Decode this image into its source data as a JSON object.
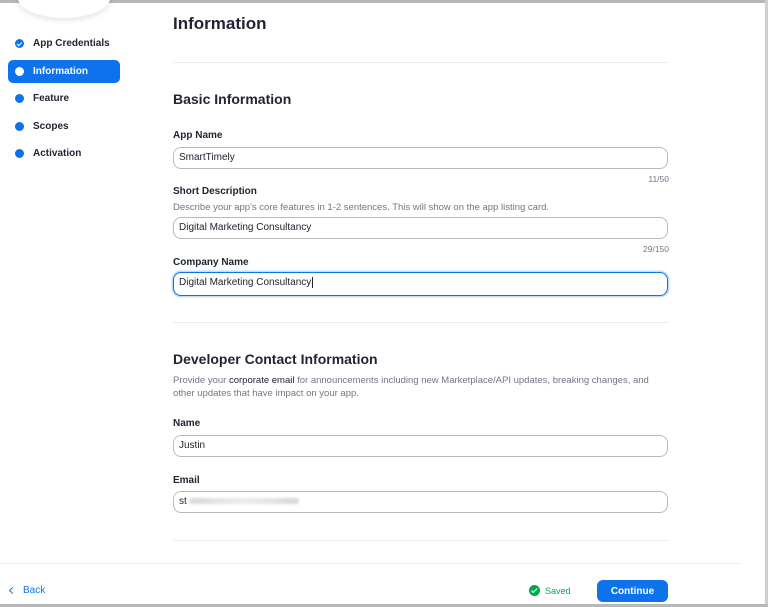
{
  "sidebar": {
    "items": [
      {
        "label": "App Credentials",
        "state": "done"
      },
      {
        "label": "Information",
        "state": "active"
      },
      {
        "label": "Feature",
        "state": "pending"
      },
      {
        "label": "Scopes",
        "state": "pending"
      },
      {
        "label": "Activation",
        "state": "pending"
      }
    ]
  },
  "page": {
    "title": "Information"
  },
  "basic": {
    "title": "Basic Information",
    "app_name": {
      "label": "App Name",
      "value": "SmartTimely",
      "counter": "11/50"
    },
    "short_description": {
      "label": "Short Description",
      "hint": "Describe your app's core features in 1-2 sentences. This will show on the app listing card.",
      "value": "Digital Marketing Consultancy",
      "counter": "29/150"
    },
    "company_name": {
      "label": "Company Name",
      "value": "Digital Marketing Consultancy"
    }
  },
  "contact": {
    "title": "Developer Contact Information",
    "hint_before": "Provide your ",
    "hint_emphasis": "corporate email",
    "hint_after": " for announcements including new Marketplace/API updates, breaking changes, and other updates that have impact on your app.",
    "name": {
      "label": "Name",
      "value": "Justin"
    },
    "email": {
      "label": "Email",
      "value": "st"
    }
  },
  "footer": {
    "back_label": "Back",
    "saved_label": "Saved",
    "continue_label": "Continue"
  },
  "colors": {
    "accent": "#0e72ed",
    "success": "#00a94f",
    "text": "#232333",
    "muted": "#747487"
  }
}
